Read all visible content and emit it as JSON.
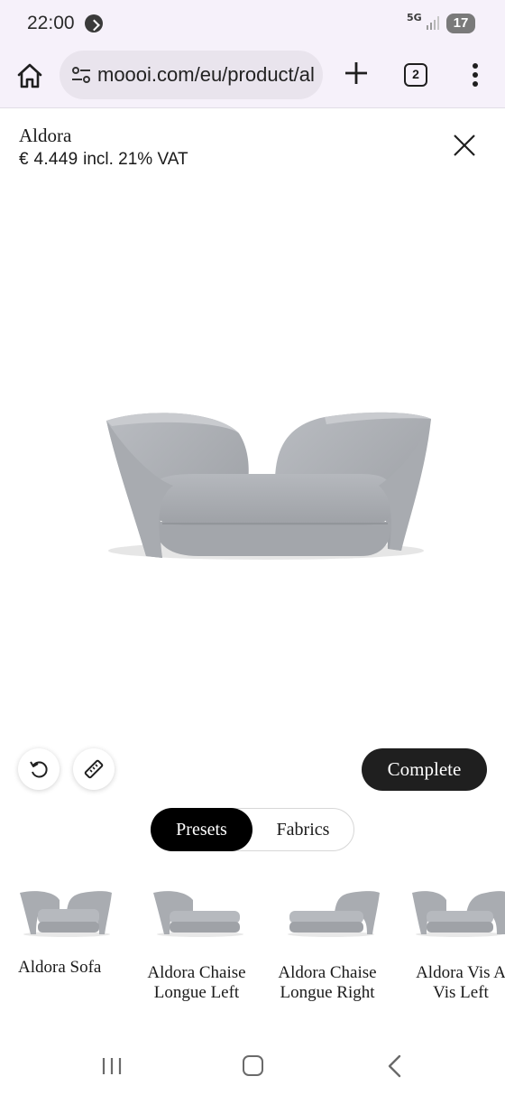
{
  "status_bar": {
    "time": "22:00",
    "network": "5G",
    "battery": "17"
  },
  "browser": {
    "url": "moooi.com/eu/product/aldora",
    "tab_count": "2"
  },
  "product": {
    "name": "Aldora",
    "price": "€ 4.449",
    "vat_note": "incl. 21% VAT"
  },
  "actions": {
    "complete_label": "Complete"
  },
  "tabs": {
    "presets_label": "Presets",
    "fabrics_label": "Fabrics",
    "active": "Presets"
  },
  "presets": [
    {
      "label": "Aldora Sofa"
    },
    {
      "label": "Aldora Chaise Longue Left"
    },
    {
      "label": "Aldora Chaise Longue Right"
    },
    {
      "label": "Aldora Vis A Vis Left"
    }
  ],
  "icons": {
    "home": "home-icon",
    "site_info": "tune-icon",
    "new_tab": "plus-icon",
    "menu": "more-vert-icon",
    "close": "close-icon",
    "reset": "rotate-ccw-icon",
    "measure": "ruler-icon"
  },
  "colors": {
    "accent_dark": "#1f1f1f",
    "browser_chrome": "#f6f1fa",
    "sofa_fabric": "#a9acb1"
  }
}
